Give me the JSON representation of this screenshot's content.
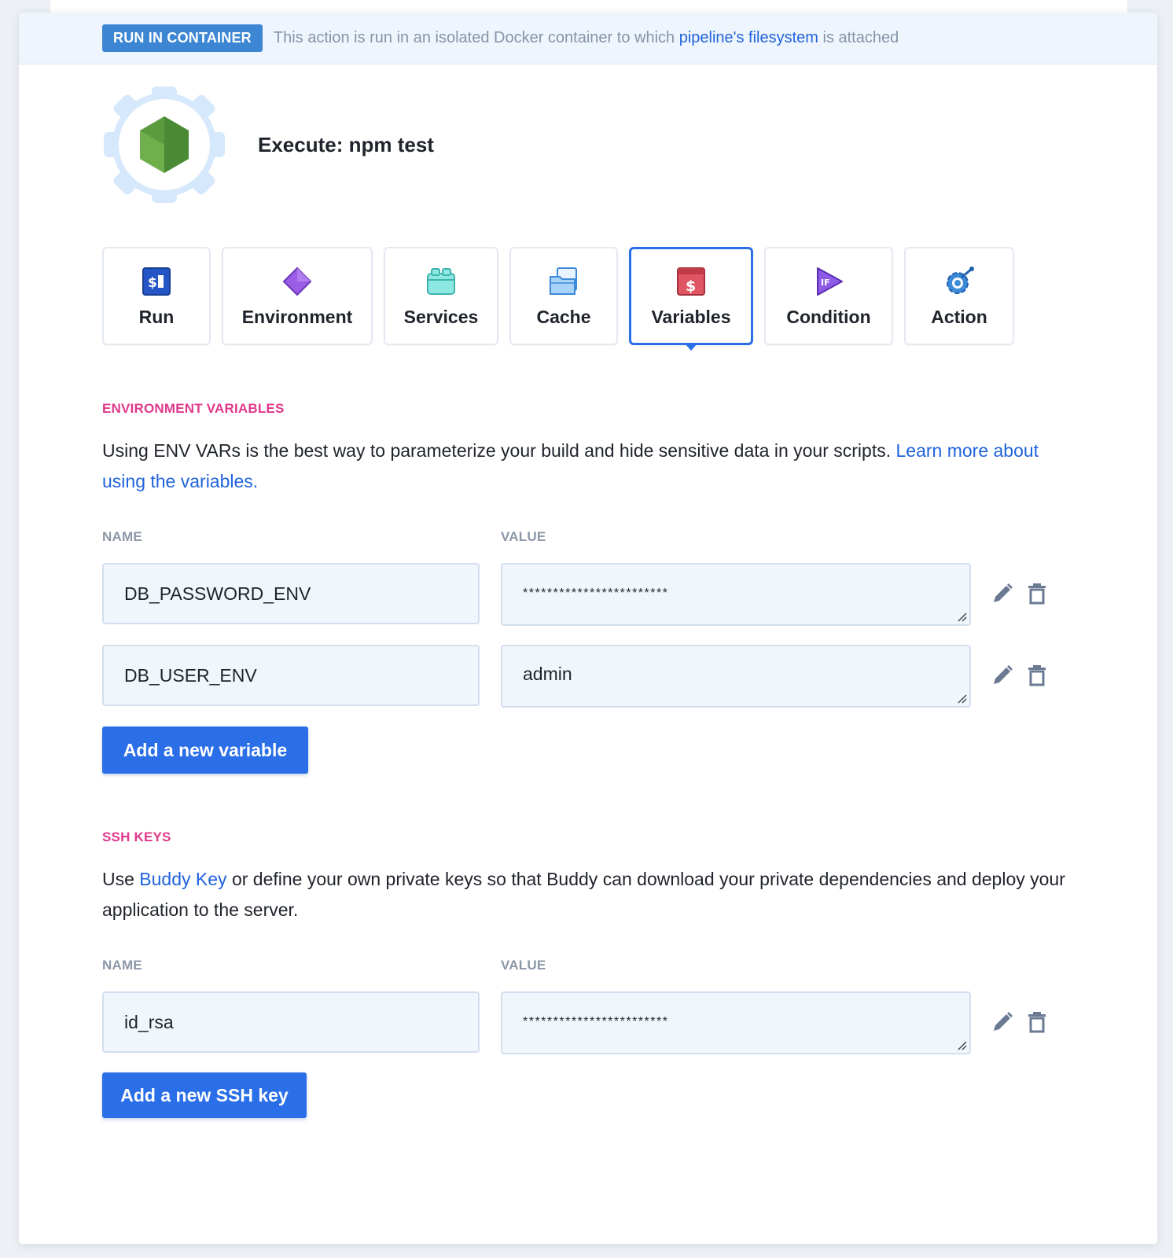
{
  "banner": {
    "badge": "RUN IN CONTAINER",
    "text_before": "This action is run in an isolated Docker container to which",
    "link": "pipeline's filesystem",
    "text_after": "is attached"
  },
  "header": {
    "title": "Execute: npm test",
    "icon": "nodejs-gear-icon"
  },
  "tabs": [
    {
      "label": "Run",
      "icon": "terminal-icon"
    },
    {
      "label": "Environment",
      "icon": "diamond-icon"
    },
    {
      "label": "Services",
      "icon": "services-icon"
    },
    {
      "label": "Cache",
      "icon": "cache-icon"
    },
    {
      "label": "Variables",
      "icon": "dollar-icon"
    },
    {
      "label": "Condition",
      "icon": "condition-if-icon"
    },
    {
      "label": "Action",
      "icon": "action-gear-icon"
    }
  ],
  "active_tab": "Variables",
  "env_vars": {
    "title": "ENVIRONMENT VARIABLES",
    "description": "Using ENV VARs is the best way to parameterize your build and hide sensitive data in your scripts.",
    "link": "Learn more about using the variables.",
    "name_label": "NAME",
    "value_label": "VALUE",
    "rows": [
      {
        "name": "DB_PASSWORD_ENV",
        "value": "************************"
      },
      {
        "name": "DB_USER_ENV",
        "value": "admin"
      }
    ],
    "add_button": "Add a new variable"
  },
  "ssh_keys": {
    "title": "SSH KEYS",
    "text_before": "Use",
    "link": "Buddy Key",
    "text_after": "or define your own private keys so that Buddy can download your private dependencies and deploy your application to the server.",
    "name_label": "NAME",
    "value_label": "VALUE",
    "rows": [
      {
        "name": "id_rsa",
        "value": "************************"
      }
    ],
    "add_button": "Add a new SSH key"
  },
  "colors": {
    "accent": "#2a6ee8",
    "section_title": "#e0388b",
    "badge": "#3c86d4",
    "link": "#1f63dd"
  }
}
